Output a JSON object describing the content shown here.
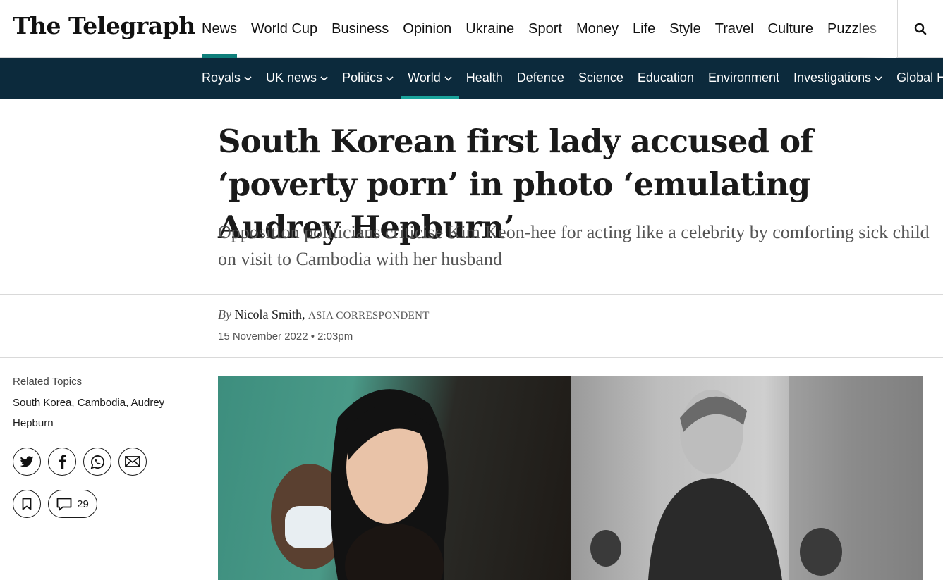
{
  "brand": {
    "logo_text": "The Telegraph",
    "accent_color": "#0f7f7b",
    "subnav_bg": "#0c2a3c"
  },
  "topnav": {
    "items": [
      {
        "label": "News",
        "active": true
      },
      {
        "label": "World Cup"
      },
      {
        "label": "Business"
      },
      {
        "label": "Opinion"
      },
      {
        "label": "Ukraine"
      },
      {
        "label": "Sport"
      },
      {
        "label": "Money"
      },
      {
        "label": "Life"
      },
      {
        "label": "Style"
      },
      {
        "label": "Travel"
      },
      {
        "label": "Culture"
      },
      {
        "label": "Puzzles"
      }
    ],
    "search_icon": "search-icon"
  },
  "subnav": {
    "items": [
      {
        "label": "Royals",
        "has_dropdown": true
      },
      {
        "label": "UK news",
        "has_dropdown": true
      },
      {
        "label": "Politics",
        "has_dropdown": true
      },
      {
        "label": "World",
        "has_dropdown": true,
        "active": true
      },
      {
        "label": "Health"
      },
      {
        "label": "Defence"
      },
      {
        "label": "Science"
      },
      {
        "label": "Education"
      },
      {
        "label": "Environment"
      },
      {
        "label": "Investigations",
        "has_dropdown": true
      },
      {
        "label": "Global H"
      }
    ]
  },
  "article": {
    "headline": "South Korean first lady accused of ‘poverty porn’ in photo ‘emulating Audrey Hepburn’",
    "standfirst": "Opposition politicians criticise Kim Keon-hee for acting like a celebrity by comforting sick child on visit to Cambodia with her husband",
    "byline": {
      "prefix": "By",
      "author": "Nicola Smith,",
      "role": "ASIA CORRESPONDENT"
    },
    "date": "15 November 2022 • 2:03pm"
  },
  "sidebar": {
    "related_title": "Related Topics",
    "topics": [
      "South Korea",
      "Cambodia",
      "Audrey Hepburn"
    ],
    "share_icons": [
      "twitter-icon",
      "facebook-icon",
      "whatsapp-icon",
      "email-icon"
    ],
    "bookmark_icon": "bookmark-icon",
    "comments_icon": "comment-icon",
    "comments_count": "29"
  }
}
